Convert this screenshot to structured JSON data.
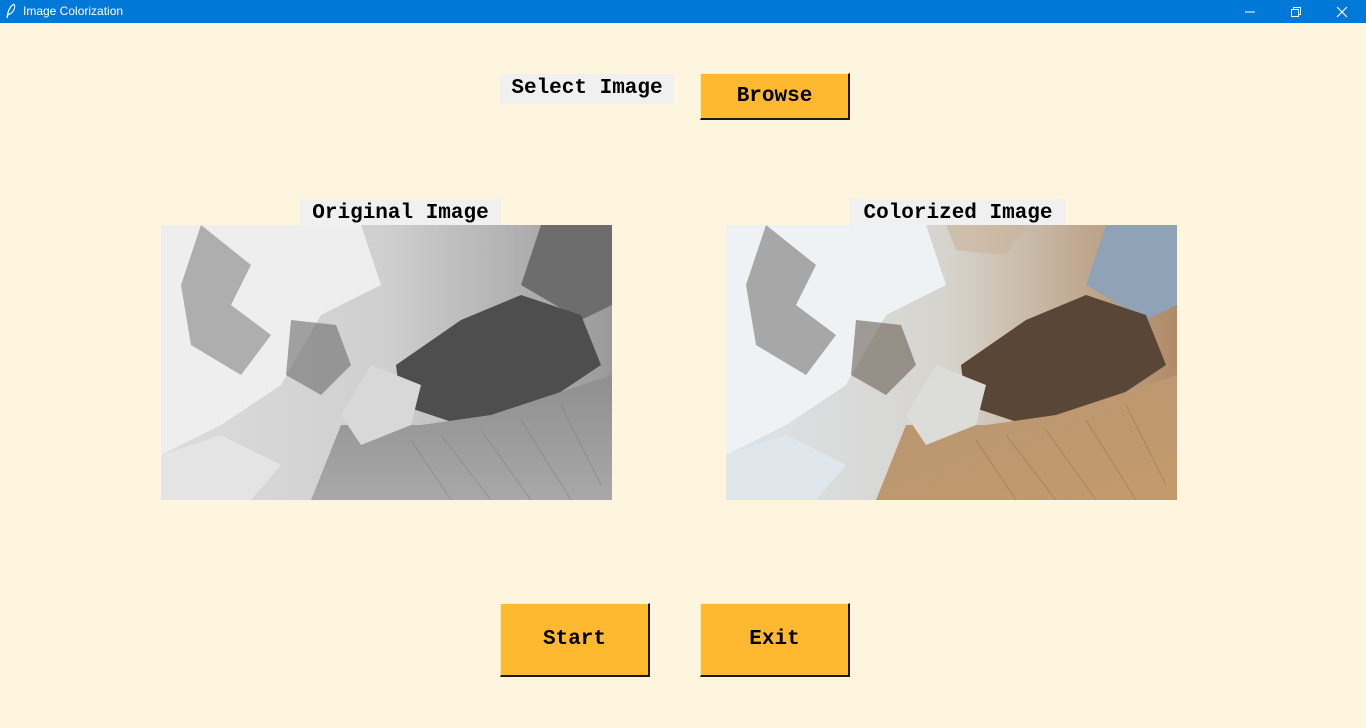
{
  "window": {
    "title": "Image Colorization",
    "icon": "feather-icon",
    "controls": [
      "minimize-icon",
      "restore-icon",
      "close-icon"
    ],
    "accent": "#0078d7"
  },
  "select": {
    "label": "Select Image",
    "browse_label": "Browse"
  },
  "panels": {
    "original_label": "Original Image",
    "colorized_label": "Colorized Image"
  },
  "actions": {
    "start_label": "Start",
    "exit_label": "Exit"
  },
  "colors": {
    "background": "#fdf5dd",
    "button": "#ffb930",
    "label_bg": "#f0f0f0"
  }
}
